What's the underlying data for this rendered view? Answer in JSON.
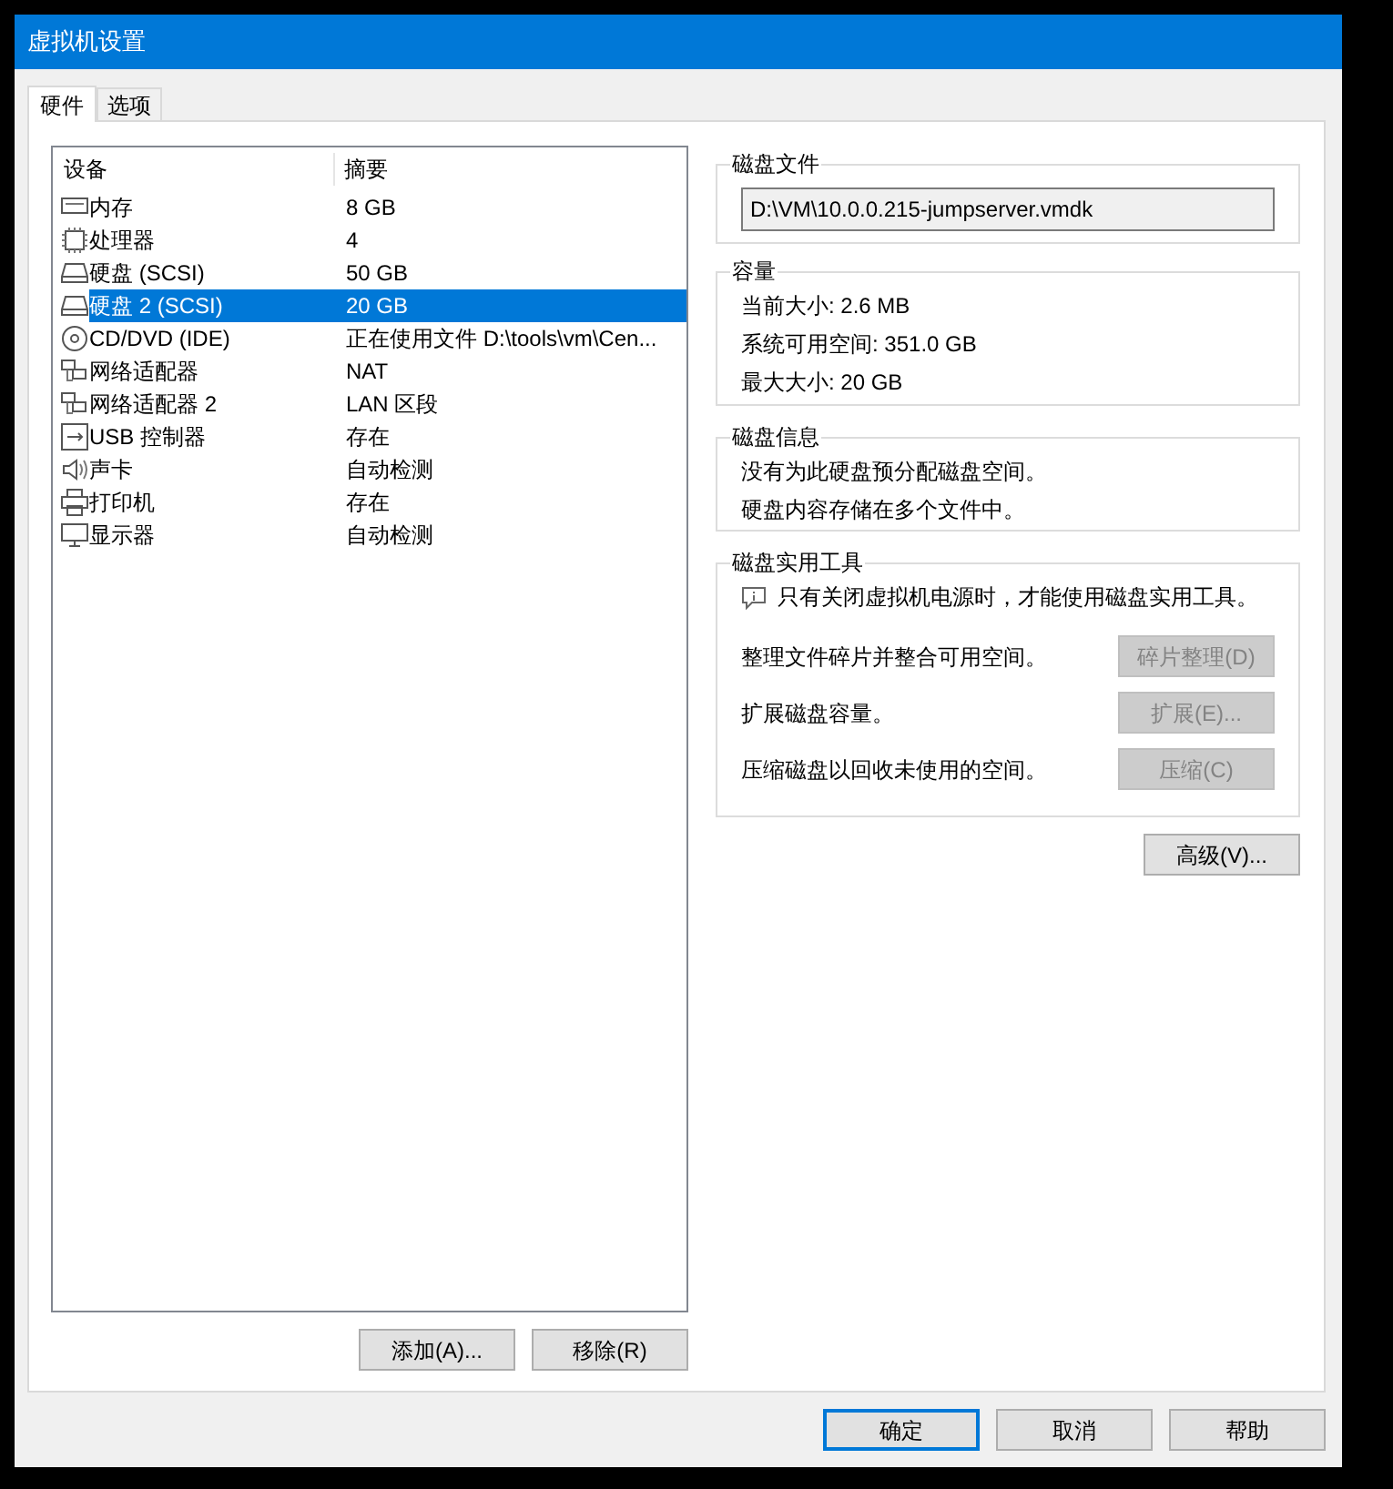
{
  "window": {
    "title": "虚拟机设置"
  },
  "tabs": [
    {
      "label": "硬件",
      "selected": true
    },
    {
      "label": "选项",
      "selected": false
    }
  ],
  "device_table": {
    "columns": [
      "设备",
      "摘要"
    ],
    "rows": [
      {
        "kind": "memory",
        "device": "内存",
        "summary": "8 GB",
        "selected": false
      },
      {
        "kind": "processor",
        "device": "处理器",
        "summary": "4",
        "selected": false
      },
      {
        "kind": "disk",
        "device": "硬盘 (SCSI)",
        "summary": "50 GB",
        "selected": false
      },
      {
        "kind": "disk",
        "device": "硬盘 2 (SCSI)",
        "summary": "20 GB",
        "selected": true
      },
      {
        "kind": "cd",
        "device": "CD/DVD (IDE)",
        "summary": "正在使用文件 D:\\tools\\vm\\Cen...",
        "selected": false
      },
      {
        "kind": "network",
        "device": "网络适配器",
        "summary": "NAT",
        "selected": false
      },
      {
        "kind": "network",
        "device": "网络适配器 2",
        "summary": "LAN 区段",
        "selected": false
      },
      {
        "kind": "usb",
        "device": "USB 控制器",
        "summary": "存在",
        "selected": false
      },
      {
        "kind": "sound",
        "device": "声卡",
        "summary": "自动检测",
        "selected": false
      },
      {
        "kind": "printer",
        "device": "打印机",
        "summary": "存在",
        "selected": false
      },
      {
        "kind": "display",
        "device": "显示器",
        "summary": "自动检测",
        "selected": false
      }
    ]
  },
  "device_buttons": [
    "添加(A)...",
    "移除(R)"
  ],
  "disk_file": {
    "title": "磁盘文件",
    "value": "D:\\VM\\10.0.0.215-jumpserver.vmdk"
  },
  "capacity": {
    "title": "容量",
    "lines": [
      "当前大小: 2.6 MB",
      "系统可用空间: 351.0 GB",
      "最大大小: 20 GB"
    ]
  },
  "disk_info": {
    "title": "磁盘信息",
    "lines": [
      "没有为此硬盘预分配磁盘空间。",
      "硬盘内容存储在多个文件中。"
    ]
  },
  "disk_utilities": {
    "title": "磁盘实用工具",
    "note": "只有关闭虚拟机电源时，才能使用磁盘实用工具。",
    "actions": [
      {
        "description": "整理文件碎片并整合可用空间。",
        "button": "碎片整理(D)",
        "disabled": true
      },
      {
        "description": "扩展磁盘容量。",
        "button": "扩展(E)...",
        "disabled": true
      },
      {
        "description": "压缩磁盘以回收未使用的空间。",
        "button": "压缩(C)",
        "disabled": true
      }
    ]
  },
  "advanced_button": "高级(V)...",
  "dialog_buttons": [
    {
      "label": "确定",
      "default": true
    },
    {
      "label": "取消",
      "default": false
    },
    {
      "label": "帮助",
      "default": false
    }
  ]
}
